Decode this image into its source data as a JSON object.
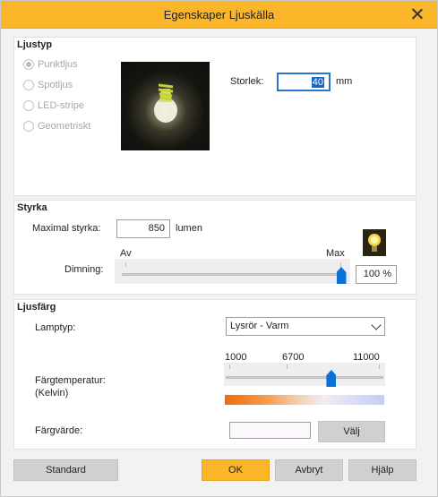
{
  "window": {
    "title": "Egenskaper Ljuskälla",
    "close_icon": "close-icon"
  },
  "ljustyp": {
    "title": "Ljustyp",
    "options": [
      "Punktljus",
      "Spotljus",
      "LED-stripe",
      "Geometriskt"
    ],
    "selected": "Punktljus",
    "storlek_label": "Storlek:",
    "storlek_value": "40",
    "storlek_unit": "mm"
  },
  "styrka": {
    "title": "Styrka",
    "max_label": "Maximal styrka:",
    "max_value": "850",
    "max_unit": "lumen",
    "dimning_label": "Dimning:",
    "slider_min_label": "Av",
    "slider_max_label": "Max",
    "dimning_value": 100,
    "dimning_text": "100 %",
    "bulb_icon": "lightbulb-icon"
  },
  "ljusfarg": {
    "title": "Ljusfärg",
    "lamptyp_label": "Lamptyp:",
    "lamptyp_value": "Lysrör - Varm",
    "temp_label_1": "Färgtemperatur:",
    "temp_label_2": "(Kelvin)",
    "temp_ticks": [
      "1000",
      "6700",
      "11000"
    ],
    "temp_range": [
      1000,
      11000
    ],
    "temp_value": 7700,
    "fargvarde_label": "Färgvärde:",
    "swatch_color": "#fbf7fd",
    "valj_label": "Välj"
  },
  "buttons": {
    "standard": "Standard",
    "ok": "OK",
    "avbryt": "Avbryt",
    "hjalp": "Hjälp"
  },
  "colors": {
    "accent": "#fab529",
    "slider_thumb": "#0a72d6"
  }
}
